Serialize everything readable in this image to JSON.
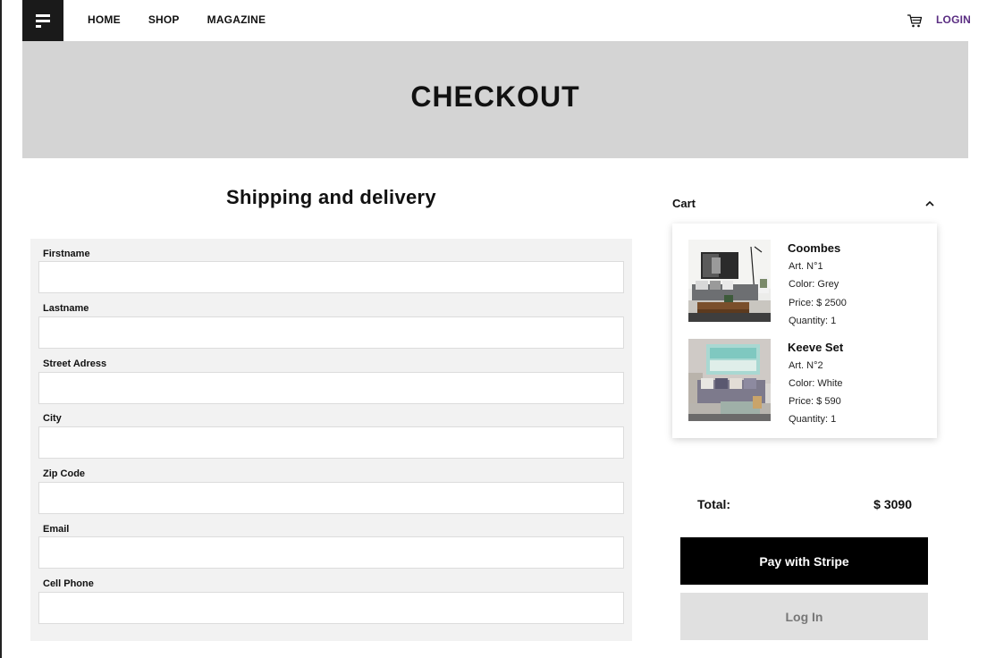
{
  "nav": {
    "links": [
      "HOME",
      "SHOP",
      "MAGAZINE"
    ],
    "login": "LOGIN",
    "cart_icon": "cart-icon",
    "logo_icon": "menu-logo-icon",
    "login_color": "#5a2d82"
  },
  "hero": {
    "title": "CHECKOUT",
    "background": "#d4d4d4"
  },
  "shipping": {
    "title": "Shipping and delivery",
    "fields": [
      {
        "label": "Firstname",
        "value": "",
        "placeholder": ""
      },
      {
        "label": "Lastname",
        "value": "",
        "placeholder": ""
      },
      {
        "label": "Street Adress",
        "value": "",
        "placeholder": ""
      },
      {
        "label": "City",
        "value": "",
        "placeholder": ""
      },
      {
        "label": "Zip Code",
        "value": "",
        "placeholder": ""
      },
      {
        "label": "Email",
        "value": "",
        "placeholder": ""
      },
      {
        "label": "Cell Phone",
        "value": "",
        "placeholder": ""
      }
    ]
  },
  "cart": {
    "title": "Cart",
    "toggle_icon": "chevron-up-icon",
    "items": [
      {
        "name": "Coombes",
        "art": "Art. N°1",
        "color": "Color: Grey",
        "price": "Price: $ 2500",
        "quantity": "Quantity: 1",
        "image": "living-room-grey-sofa-photo"
      },
      {
        "name": "Keeve Set",
        "art": "Art. N°2",
        "color": "Color: White",
        "price": "Price: $ 590",
        "quantity": "Quantity: 1",
        "image": "living-room-lilac-sofa-photo"
      }
    ],
    "total_label": "Total:",
    "total_value": "$ 3090"
  },
  "actions": {
    "pay": "Pay with Stripe",
    "login": "Log In"
  }
}
